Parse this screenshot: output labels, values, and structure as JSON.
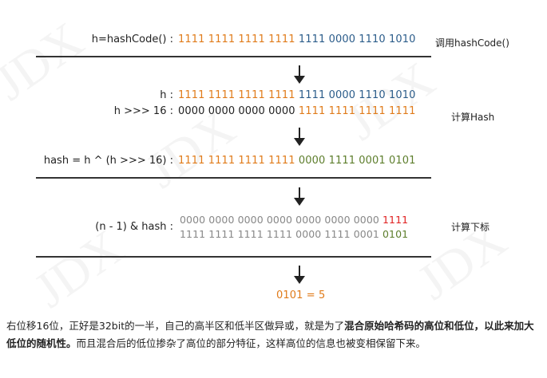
{
  "rows": {
    "hashcode": {
      "label": "h=hashCode() :",
      "side": "调用hashCode()",
      "segments": [
        {
          "text": "1111 1111 1111 1111 ",
          "color": "o"
        },
        {
          "text": "1111 0000 1110 1010",
          "color": "b"
        }
      ]
    },
    "h": {
      "label": "h :",
      "segments": [
        {
          "text": "1111 1111 1111 1111 ",
          "color": "o"
        },
        {
          "text": "1111 0000 1110 1010",
          "color": "b"
        }
      ]
    },
    "shift": {
      "label": "h >>> 16 :",
      "side": "计算Hash",
      "segments": [
        {
          "text": "0000 0000 0000 0000 ",
          "color": "k"
        },
        {
          "text": "1111 1111 1111 1111",
          "color": "o"
        }
      ]
    },
    "hash": {
      "label": "hash = h ^ (h >>> 16) :",
      "segments": [
        {
          "text": "1111 1111 1111 1111 ",
          "color": "o"
        },
        {
          "text": "0000 1111 0001 0101",
          "color": "g"
        }
      ]
    },
    "mask_top": {
      "label": "(n - 1) & hash :",
      "side": "计算下标",
      "segments": [
        {
          "text": "0000 0000 0000 0000 0000 0000 0000 ",
          "color": "gr"
        },
        {
          "text": "1111",
          "color": "r"
        }
      ]
    },
    "mask_bottom": {
      "segments": [
        {
          "text": "1111 1111 1111 1111 0000 1111 0001 ",
          "color": "gr"
        },
        {
          "text": "0101",
          "color": "g"
        }
      ]
    },
    "result": "0101 = 5"
  },
  "paragraph": {
    "p1": "右位移16位，正好是32bit的一半，自己的高半区和低半区做异或，就是为了",
    "p2_bold": "混合原始哈希码的高位和低位，以此来加大低位的随机性。",
    "p3": "而且混合后的低位掺杂了高位的部分特征，这样高位的信息也被变相保留下来。"
  },
  "watermark": "JDX"
}
